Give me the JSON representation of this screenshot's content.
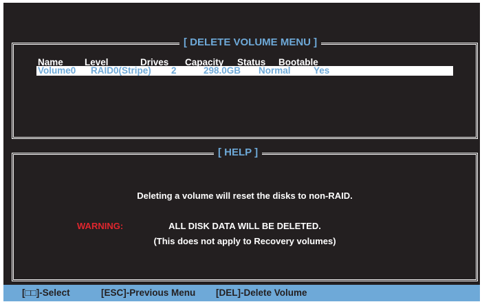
{
  "delete_menu": {
    "title": "[ DELETE VOLUME MENU ]",
    "columns": [
      "Name",
      "Level",
      "Drives",
      "Capacity",
      "Status",
      "Bootable"
    ],
    "volume": {
      "name": "Volume0",
      "level": "RAID0(Stripe)",
      "drives": "2",
      "capacity": "298.0GB",
      "status": "Normal",
      "bootable": "Yes"
    }
  },
  "help": {
    "title": "[ HELP ]",
    "line1": "Deleting a volume will reset the disks to non-RAID.",
    "warning_label": "WARNING:",
    "warning_line": "ALL DISK DATA WILL BE DELETED.",
    "note_line": "(This does not apply to Recovery volumes)"
  },
  "footer": {
    "select": "[□□]-Select",
    "esc": "[ESC]-Previous Menu",
    "del": "[DEL]-Delete Volume"
  },
  "colors": {
    "background": "#231f20",
    "accent": "#6ea9d8",
    "warning": "#e0262e",
    "text": "#ffffff"
  }
}
